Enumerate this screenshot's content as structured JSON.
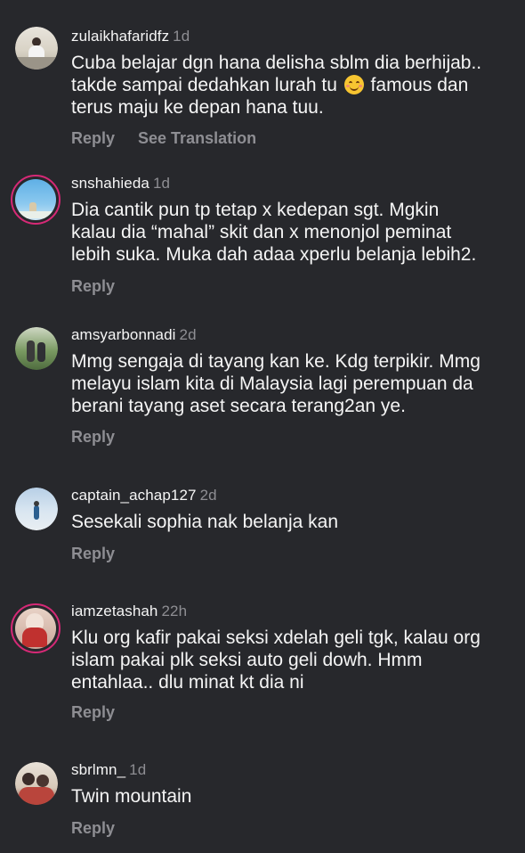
{
  "comments": [
    {
      "username": "zulaikhafaridfz",
      "time": "1d",
      "text_lines": [
        "Cuba belajar dgn hana delisha sblm dia berhijab..",
        "takde sampai dedahkan lurah tu",
        " famous dan",
        "terus maju ke depan hana tuu."
      ],
      "emoji_icon": "smiling-face-emoji",
      "reply": "Reply",
      "translate": "See Translation"
    },
    {
      "username": "snshahieda",
      "time": "1d",
      "text_lines": [
        "Dia cantik pun tp tetap x kedepan sgt. Mgkin",
        "kalau dia “mahal” skit dan x menonjol peminat",
        "lebih suka. Muka dah adaa xperlu belanja lebih2."
      ],
      "reply": "Reply"
    },
    {
      "username": "amsyarbonnadi",
      "time": "2d",
      "text_lines": [
        "Mmg sengaja di tayang kan ke. Kdg terpikir. Mmg",
        "melayu islam kita di Malaysia lagi perempuan da",
        "berani tayang aset secara terang2an ye."
      ],
      "reply": "Reply"
    },
    {
      "username": "captain_achap127",
      "time": "2d",
      "text_lines": [
        "Sesekali sophia nak belanja kan"
      ],
      "reply": "Reply"
    },
    {
      "username": "iamzetashah",
      "time": "22h",
      "text_lines": [
        "Klu org kafir pakai seksi xdelah geli tgk, kalau org",
        "islam pakai plk seksi auto geli dowh. Hmm",
        "entahlaa.. dlu minat kt dia ni"
      ],
      "reply": "Reply"
    },
    {
      "username": "sbrlmn_",
      "time": "1d",
      "text_lines": [
        "Twin mountain"
      ],
      "reply": "Reply"
    }
  ],
  "colors": {
    "background": "#27282c",
    "secondary_text": "#8e8e93",
    "story_ring": "#d62976"
  }
}
